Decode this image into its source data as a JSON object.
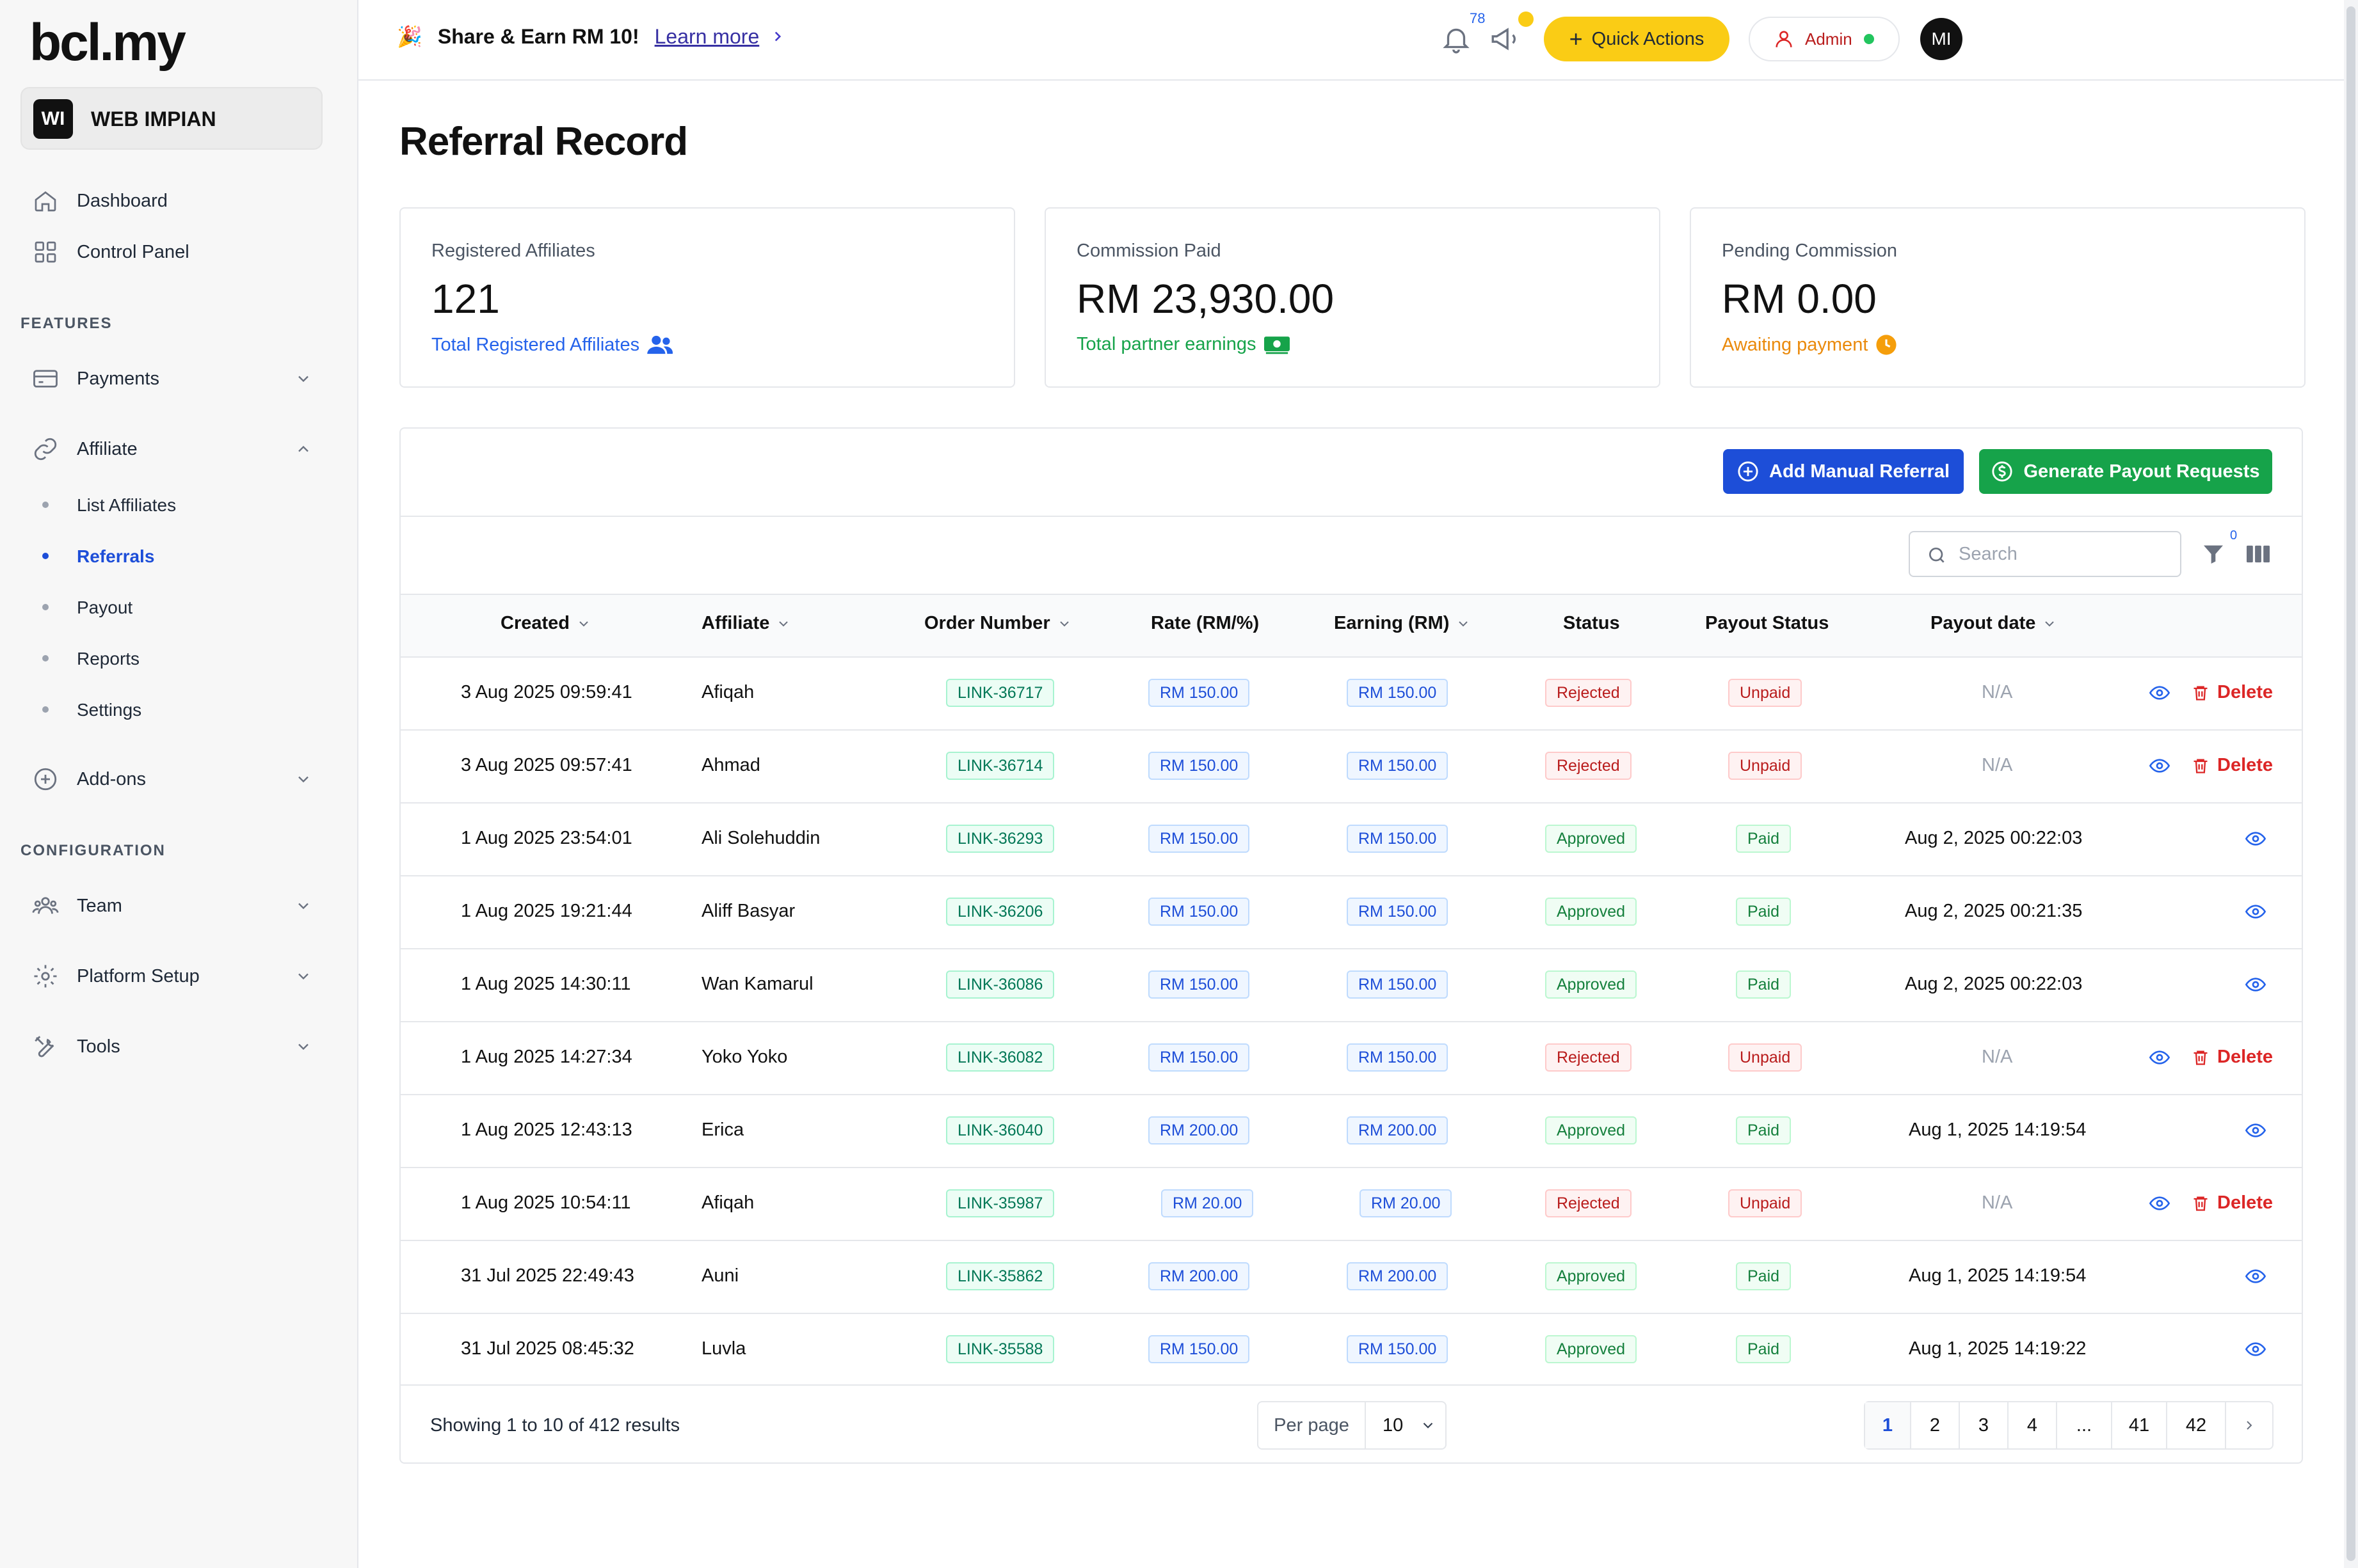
{
  "brand": {
    "logo_text_1": "bcl",
    "logo_dot": ".",
    "logo_text_2": "my"
  },
  "workspace": {
    "badge": "WI",
    "name": "WEB IMPIAN"
  },
  "sidebar": {
    "top_items": [
      {
        "label": "Dashboard",
        "icon": "home-icon"
      },
      {
        "label": "Control Panel",
        "icon": "grid-icon"
      }
    ],
    "features_label": "FEATURES",
    "payments": "Payments",
    "affiliate": "Affiliate",
    "affiliate_sub": [
      "List Affiliates",
      "Referrals",
      "Payout",
      "Reports",
      "Settings"
    ],
    "addons": "Add-ons",
    "config_label": "CONFIGURATION",
    "team": "Team",
    "platform_setup": "Platform Setup",
    "tools": "Tools"
  },
  "topbar": {
    "promo_text": "Share & Earn RM 10!",
    "learn_more": "Learn more",
    "notification_count": "78",
    "quick_actions": "Quick Actions",
    "admin": "Admin",
    "avatar": "MI"
  },
  "page": {
    "title": "Referral Record"
  },
  "cards": [
    {
      "label": "Registered Affiliates",
      "value": "121",
      "sub": "Total Registered Affiliates",
      "color": "#2563eb"
    },
    {
      "label": "Commission Paid",
      "value": "RM 23,930.00",
      "sub": "Total partner earnings",
      "color": "#16a34a"
    },
    {
      "label": "Pending Commission",
      "value": "RM 0.00",
      "sub": "Awaiting payment",
      "color": "#ea8a0c"
    }
  ],
  "actions": {
    "add_manual": "Add Manual Referral",
    "generate_payout": "Generate Payout Requests"
  },
  "search": {
    "placeholder": "Search"
  },
  "filter_count": "0",
  "table": {
    "headers": [
      "Created",
      "Affiliate",
      "Order Number",
      "Rate (RM/%)",
      "Earning (RM)",
      "Status",
      "Payout Status",
      "Payout date"
    ],
    "delete_label": "Delete",
    "rows": [
      {
        "created": "3 Aug 2025 09:59:41",
        "affiliate": "Afiqah",
        "order": "LINK-36717",
        "rate": "RM 150.00",
        "earning": "RM 150.00",
        "status": "Rejected",
        "payout_status": "Unpaid",
        "payout_date": "N/A"
      },
      {
        "created": "3 Aug 2025 09:57:41",
        "affiliate": "Ahmad",
        "order": "LINK-36714",
        "rate": "RM 150.00",
        "earning": "RM 150.00",
        "status": "Rejected",
        "payout_status": "Unpaid",
        "payout_date": "N/A"
      },
      {
        "created": "1 Aug 2025 23:54:01",
        "affiliate": "Ali Solehuddin",
        "order": "LINK-36293",
        "rate": "RM 150.00",
        "earning": "RM 150.00",
        "status": "Approved",
        "payout_status": "Paid",
        "payout_date": "Aug 2, 2025 00:22:03"
      },
      {
        "created": "1 Aug 2025 19:21:44",
        "affiliate": "Aliff Basyar",
        "order": "LINK-36206",
        "rate": "RM 150.00",
        "earning": "RM 150.00",
        "status": "Approved",
        "payout_status": "Paid",
        "payout_date": "Aug 2, 2025 00:21:35"
      },
      {
        "created": "1 Aug 2025 14:30:11",
        "affiliate": "Wan Kamarul",
        "order": "LINK-36086",
        "rate": "RM 150.00",
        "earning": "RM 150.00",
        "status": "Approved",
        "payout_status": "Paid",
        "payout_date": "Aug 2, 2025 00:22:03"
      },
      {
        "created": "1 Aug 2025 14:27:34",
        "affiliate": "Yoko Yoko",
        "order": "LINK-36082",
        "rate": "RM 150.00",
        "earning": "RM 150.00",
        "status": "Rejected",
        "payout_status": "Unpaid",
        "payout_date": "N/A"
      },
      {
        "created": "1 Aug 2025 12:43:13",
        "affiliate": "Erica",
        "order": "LINK-36040",
        "rate": "RM 200.00",
        "earning": "RM 200.00",
        "status": "Approved",
        "payout_status": "Paid",
        "payout_date": "Aug 1, 2025 14:19:54"
      },
      {
        "created": "1 Aug 2025 10:54:11",
        "affiliate": "Afiqah",
        "order": "LINK-35987",
        "rate": "RM 20.00",
        "earning": "RM 20.00",
        "status": "Rejected",
        "payout_status": "Unpaid",
        "payout_date": "N/A"
      },
      {
        "created": "31 Jul 2025 22:49:43",
        "affiliate": "Auni",
        "order": "LINK-35862",
        "rate": "RM 200.00",
        "earning": "RM 200.00",
        "status": "Approved",
        "payout_status": "Paid",
        "payout_date": "Aug 1, 2025 14:19:54"
      },
      {
        "created": "31 Jul 2025 08:45:32",
        "affiliate": "Luvla",
        "order": "LINK-35588",
        "rate": "RM 150.00",
        "earning": "RM 150.00",
        "status": "Approved",
        "payout_status": "Paid",
        "payout_date": "Aug 1, 2025 14:19:22"
      }
    ]
  },
  "footer": {
    "showing": "Showing 1 to 10 of 412 results",
    "per_page_label": "Per page",
    "per_page_value": "10",
    "pages": [
      "1",
      "2",
      "3",
      "4",
      "...",
      "41",
      "42"
    ]
  }
}
